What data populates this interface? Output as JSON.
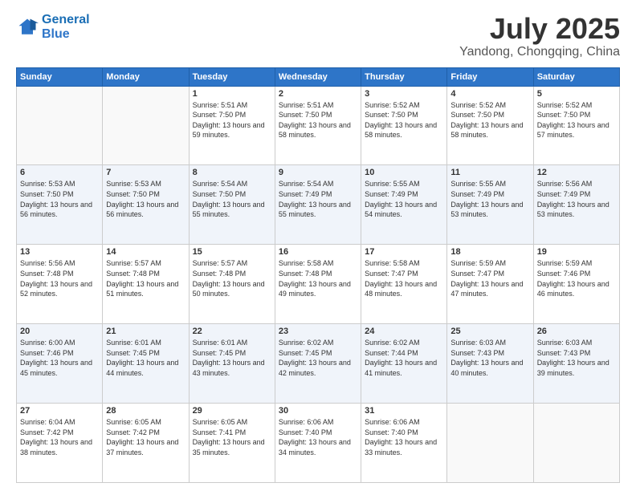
{
  "logo": {
    "line1": "General",
    "line2": "Blue"
  },
  "header": {
    "month": "July 2025",
    "location": "Yandong, Chongqing, China"
  },
  "weekdays": [
    "Sunday",
    "Monday",
    "Tuesday",
    "Wednesday",
    "Thursday",
    "Friday",
    "Saturday"
  ],
  "weeks": [
    [
      {
        "day": "",
        "sunrise": "",
        "sunset": "",
        "daylight": ""
      },
      {
        "day": "",
        "sunrise": "",
        "sunset": "",
        "daylight": ""
      },
      {
        "day": "1",
        "sunrise": "Sunrise: 5:51 AM",
        "sunset": "Sunset: 7:50 PM",
        "daylight": "Daylight: 13 hours and 59 minutes."
      },
      {
        "day": "2",
        "sunrise": "Sunrise: 5:51 AM",
        "sunset": "Sunset: 7:50 PM",
        "daylight": "Daylight: 13 hours and 58 minutes."
      },
      {
        "day": "3",
        "sunrise": "Sunrise: 5:52 AM",
        "sunset": "Sunset: 7:50 PM",
        "daylight": "Daylight: 13 hours and 58 minutes."
      },
      {
        "day": "4",
        "sunrise": "Sunrise: 5:52 AM",
        "sunset": "Sunset: 7:50 PM",
        "daylight": "Daylight: 13 hours and 58 minutes."
      },
      {
        "day": "5",
        "sunrise": "Sunrise: 5:52 AM",
        "sunset": "Sunset: 7:50 PM",
        "daylight": "Daylight: 13 hours and 57 minutes."
      }
    ],
    [
      {
        "day": "6",
        "sunrise": "Sunrise: 5:53 AM",
        "sunset": "Sunset: 7:50 PM",
        "daylight": "Daylight: 13 hours and 56 minutes."
      },
      {
        "day": "7",
        "sunrise": "Sunrise: 5:53 AM",
        "sunset": "Sunset: 7:50 PM",
        "daylight": "Daylight: 13 hours and 56 minutes."
      },
      {
        "day": "8",
        "sunrise": "Sunrise: 5:54 AM",
        "sunset": "Sunset: 7:50 PM",
        "daylight": "Daylight: 13 hours and 55 minutes."
      },
      {
        "day": "9",
        "sunrise": "Sunrise: 5:54 AM",
        "sunset": "Sunset: 7:49 PM",
        "daylight": "Daylight: 13 hours and 55 minutes."
      },
      {
        "day": "10",
        "sunrise": "Sunrise: 5:55 AM",
        "sunset": "Sunset: 7:49 PM",
        "daylight": "Daylight: 13 hours and 54 minutes."
      },
      {
        "day": "11",
        "sunrise": "Sunrise: 5:55 AM",
        "sunset": "Sunset: 7:49 PM",
        "daylight": "Daylight: 13 hours and 53 minutes."
      },
      {
        "day": "12",
        "sunrise": "Sunrise: 5:56 AM",
        "sunset": "Sunset: 7:49 PM",
        "daylight": "Daylight: 13 hours and 53 minutes."
      }
    ],
    [
      {
        "day": "13",
        "sunrise": "Sunrise: 5:56 AM",
        "sunset": "Sunset: 7:48 PM",
        "daylight": "Daylight: 13 hours and 52 minutes."
      },
      {
        "day": "14",
        "sunrise": "Sunrise: 5:57 AM",
        "sunset": "Sunset: 7:48 PM",
        "daylight": "Daylight: 13 hours and 51 minutes."
      },
      {
        "day": "15",
        "sunrise": "Sunrise: 5:57 AM",
        "sunset": "Sunset: 7:48 PM",
        "daylight": "Daylight: 13 hours and 50 minutes."
      },
      {
        "day": "16",
        "sunrise": "Sunrise: 5:58 AM",
        "sunset": "Sunset: 7:48 PM",
        "daylight": "Daylight: 13 hours and 49 minutes."
      },
      {
        "day": "17",
        "sunrise": "Sunrise: 5:58 AM",
        "sunset": "Sunset: 7:47 PM",
        "daylight": "Daylight: 13 hours and 48 minutes."
      },
      {
        "day": "18",
        "sunrise": "Sunrise: 5:59 AM",
        "sunset": "Sunset: 7:47 PM",
        "daylight": "Daylight: 13 hours and 47 minutes."
      },
      {
        "day": "19",
        "sunrise": "Sunrise: 5:59 AM",
        "sunset": "Sunset: 7:46 PM",
        "daylight": "Daylight: 13 hours and 46 minutes."
      }
    ],
    [
      {
        "day": "20",
        "sunrise": "Sunrise: 6:00 AM",
        "sunset": "Sunset: 7:46 PM",
        "daylight": "Daylight: 13 hours and 45 minutes."
      },
      {
        "day": "21",
        "sunrise": "Sunrise: 6:01 AM",
        "sunset": "Sunset: 7:45 PM",
        "daylight": "Daylight: 13 hours and 44 minutes."
      },
      {
        "day": "22",
        "sunrise": "Sunrise: 6:01 AM",
        "sunset": "Sunset: 7:45 PM",
        "daylight": "Daylight: 13 hours and 43 minutes."
      },
      {
        "day": "23",
        "sunrise": "Sunrise: 6:02 AM",
        "sunset": "Sunset: 7:45 PM",
        "daylight": "Daylight: 13 hours and 42 minutes."
      },
      {
        "day": "24",
        "sunrise": "Sunrise: 6:02 AM",
        "sunset": "Sunset: 7:44 PM",
        "daylight": "Daylight: 13 hours and 41 minutes."
      },
      {
        "day": "25",
        "sunrise": "Sunrise: 6:03 AM",
        "sunset": "Sunset: 7:43 PM",
        "daylight": "Daylight: 13 hours and 40 minutes."
      },
      {
        "day": "26",
        "sunrise": "Sunrise: 6:03 AM",
        "sunset": "Sunset: 7:43 PM",
        "daylight": "Daylight: 13 hours and 39 minutes."
      }
    ],
    [
      {
        "day": "27",
        "sunrise": "Sunrise: 6:04 AM",
        "sunset": "Sunset: 7:42 PM",
        "daylight": "Daylight: 13 hours and 38 minutes."
      },
      {
        "day": "28",
        "sunrise": "Sunrise: 6:05 AM",
        "sunset": "Sunset: 7:42 PM",
        "daylight": "Daylight: 13 hours and 37 minutes."
      },
      {
        "day": "29",
        "sunrise": "Sunrise: 6:05 AM",
        "sunset": "Sunset: 7:41 PM",
        "daylight": "Daylight: 13 hours and 35 minutes."
      },
      {
        "day": "30",
        "sunrise": "Sunrise: 6:06 AM",
        "sunset": "Sunset: 7:40 PM",
        "daylight": "Daylight: 13 hours and 34 minutes."
      },
      {
        "day": "31",
        "sunrise": "Sunrise: 6:06 AM",
        "sunset": "Sunset: 7:40 PM",
        "daylight": "Daylight: 13 hours and 33 minutes."
      },
      {
        "day": "",
        "sunrise": "",
        "sunset": "",
        "daylight": ""
      },
      {
        "day": "",
        "sunrise": "",
        "sunset": "",
        "daylight": ""
      }
    ]
  ]
}
